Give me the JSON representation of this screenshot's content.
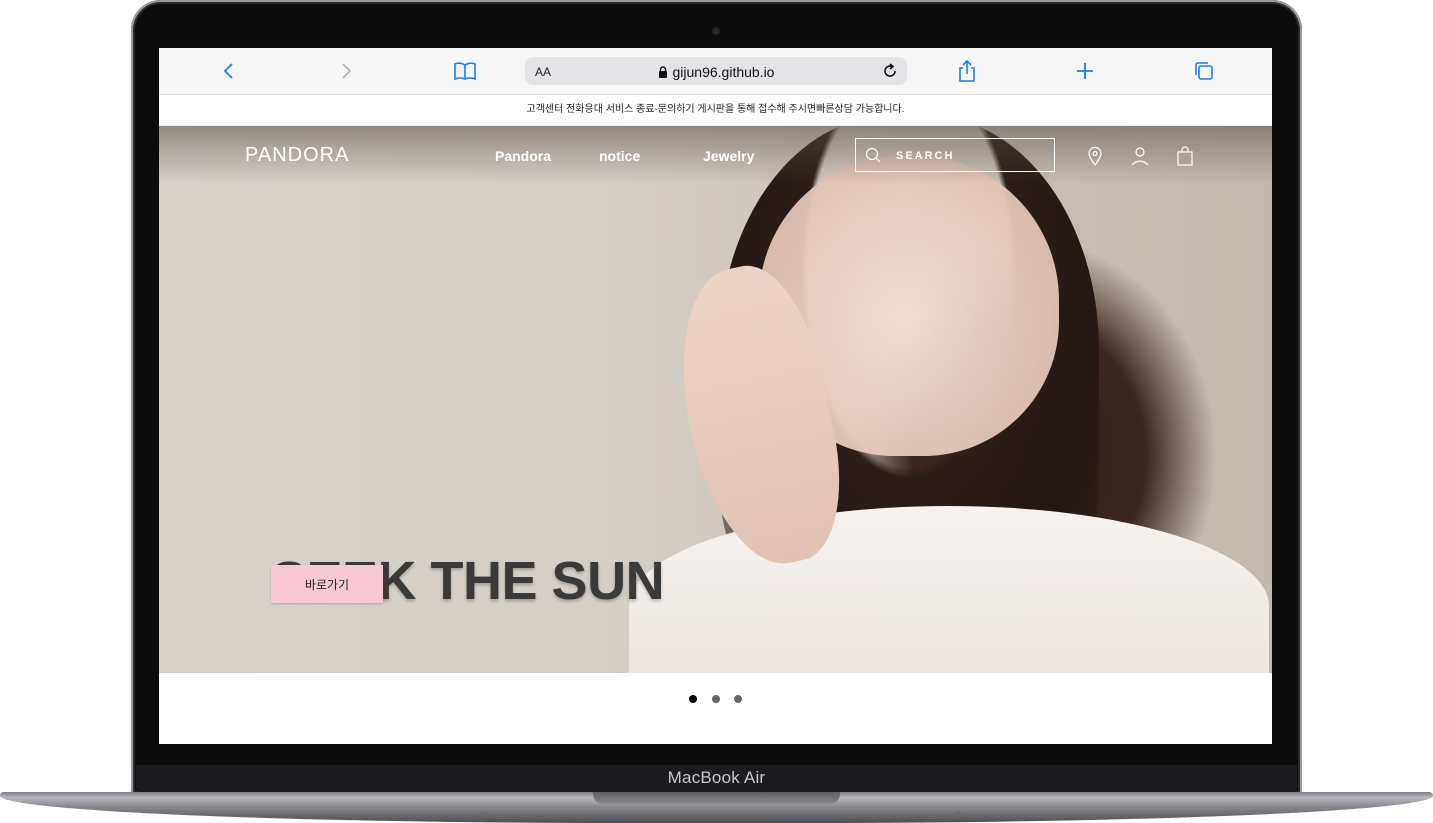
{
  "browser": {
    "text_size_label": "AA",
    "url": "gijun96.github.io",
    "icons": [
      "back-icon",
      "forward-icon",
      "bookmarks-icon",
      "lock-icon",
      "reload-icon",
      "share-icon",
      "new-tab-icon",
      "tabs-icon"
    ],
    "accent_color": "#1a7cf4"
  },
  "notice_bar": {
    "text": "고객센터 전화응대 서비스 종료-문의하기 게시판을 통해 접수해 주시면빠른상담 가능합니다."
  },
  "header": {
    "logo": "PANDORA",
    "nav": [
      "Pandora",
      "notice",
      "Jewelry"
    ],
    "search_placeholder": "SEARCH",
    "icons": [
      "location-icon",
      "user-icon",
      "shopping-bag-icon"
    ]
  },
  "hero": {
    "title": "SEEK THE SUN",
    "button_label": "바로가기",
    "button_color": "#f8c9d4"
  },
  "carousel": {
    "slide_count": 3,
    "active_index": 0
  },
  "device": {
    "label": "MacBook Air"
  }
}
